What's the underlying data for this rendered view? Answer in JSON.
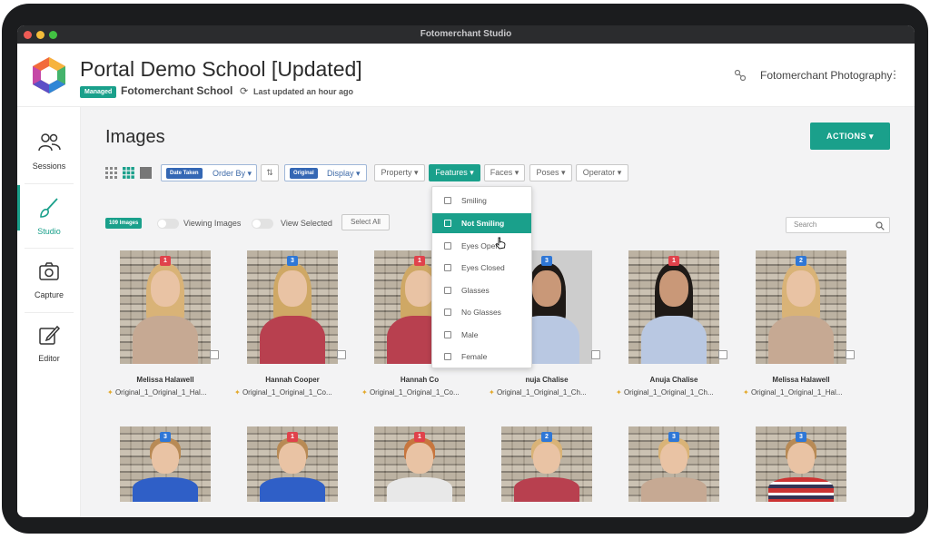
{
  "window": {
    "title": "Fotomerchant Studio"
  },
  "header": {
    "title": "Portal Demo School [Updated]",
    "badge": "Managed",
    "org": "Fotomerchant School",
    "updated": "Last updated an hour ago",
    "studio": "Fotomerchant Photography"
  },
  "sidebar": {
    "items": [
      {
        "label": "Sessions",
        "icon": "users-icon"
      },
      {
        "label": "Studio",
        "icon": "brush-icon"
      },
      {
        "label": "Capture",
        "icon": "camera-icon"
      },
      {
        "label": "Editor",
        "icon": "edit-icon"
      }
    ]
  },
  "main": {
    "title": "Images",
    "actions": "ACTIONS ▾",
    "order_pill": "Date Taken",
    "order_label": "Order By ▾",
    "display_pill": "Original",
    "display_label": "Display ▾",
    "filters": [
      "Property ▾",
      "Features ▾",
      "Faces ▾",
      "Poses ▾",
      "Operator ▾"
    ],
    "count": "109 Images",
    "viewing": "Viewing Images",
    "view_selected": "View Selected",
    "select_all": "Select All",
    "search_placeholder": "Search"
  },
  "dropdown": {
    "items": [
      "Smiling",
      "Not Smiling",
      "Eyes Open",
      "Eyes Closed",
      "Glasses",
      "No Glasses",
      "Male",
      "Female"
    ],
    "selected": "Not Smiling"
  },
  "images_row1": [
    {
      "badge": "1",
      "name": "Melissa Halawell",
      "file": "Original_1_Original_1_Hal..."
    },
    {
      "badge": "3",
      "name": "Hannah Cooper",
      "file": "Original_1_Original_1_Co..."
    },
    {
      "badge": "1",
      "name": "Hannah Co",
      "file": "Original_1_Original_1_Co..."
    },
    {
      "badge": "3",
      "name": "nuja Chalise",
      "file": "Original_1_Original_1_Ch..."
    },
    {
      "badge": "1",
      "name": "Anuja Chalise",
      "file": "Original_1_Original_1_Ch..."
    },
    {
      "badge": "2",
      "name": "Melissa Halawell",
      "file": "Original_1_Original_1_Hal..."
    }
  ],
  "images_row2": [
    {
      "badge": "3"
    },
    {
      "badge": "1"
    },
    {
      "badge": "1"
    },
    {
      "badge": "2"
    },
    {
      "badge": "3"
    },
    {
      "badge": "3"
    }
  ],
  "colors": {
    "accent": "#1aa08b",
    "badge_red": "#e0424b",
    "badge_blue": "#2f77d6",
    "pill_blue": "#3467b4"
  }
}
